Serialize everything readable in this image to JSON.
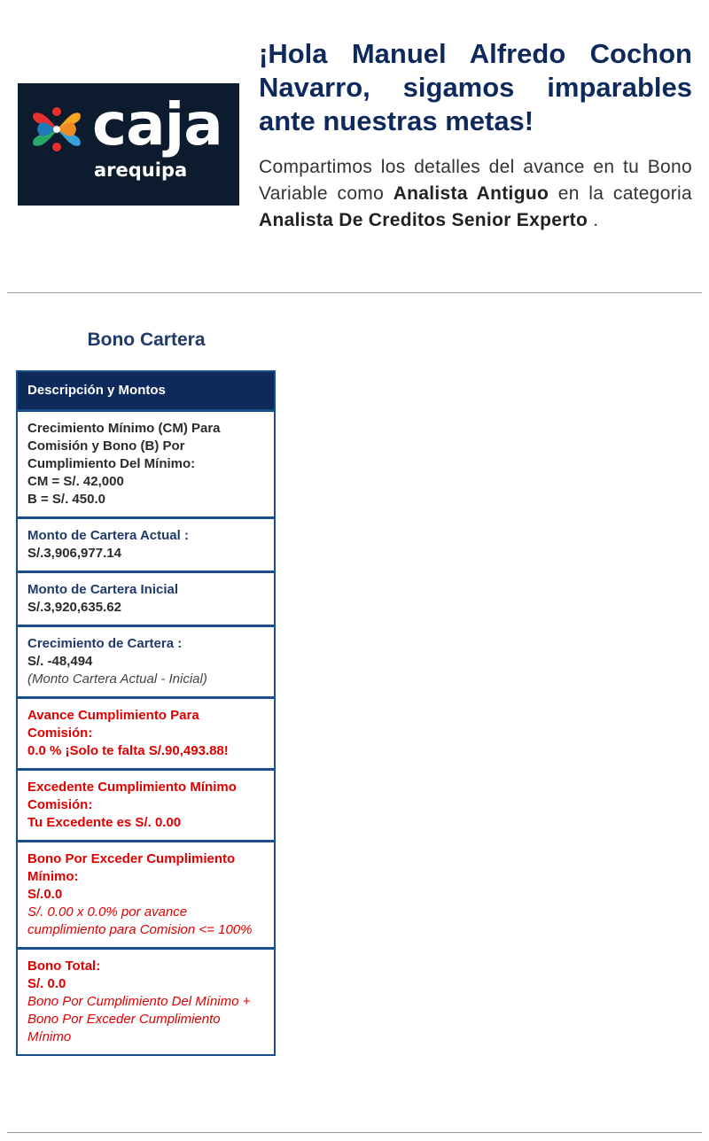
{
  "logo": {
    "word": "caja",
    "sub": "arequipa"
  },
  "header": {
    "greeting": "¡Hola Manuel Alfredo Cochon Navarro, sigamos imparables ante nuestras metas!",
    "intro": {
      "text_1": "Compartimos los detalles del avance en tu Bono Variable como ",
      "role": "Analista Antiguo",
      "text_2": " en la categoria ",
      "category": "Analista De Creditos Senior Experto",
      "text_3": " ."
    }
  },
  "section": {
    "title": "Bono Cartera"
  },
  "table": {
    "header": "Descripción y Montos",
    "rows": [
      {
        "label": "Crecimiento Mínimo (CM) Para Comisión y Bono (B) Por Cumplimiento Del Mínimo:",
        "value": "CM = S/. 42,000",
        "value2": "B = S/. 450.0"
      },
      {
        "label": "Monto de Cartera Actual :",
        "value": "S/.3,906,977.14"
      },
      {
        "label": "Monto de Cartera Inicial",
        "value": "S/.3,920,635.62"
      },
      {
        "label": "Crecimiento de Cartera :",
        "value": "S/. -48,494",
        "note": "(Monto Cartera Actual - Inicial)"
      },
      {
        "label": "Avance Cumplimiento Para Comisión:",
        "value": "0.0 % ¡Solo te falta S/.90,493.88!"
      },
      {
        "label": "Excedente Cumplimiento Mínimo Comisión:",
        "value": "Tu Excedente es S/. 0.00"
      },
      {
        "label": "Bono Por Exceder Cumplimiento Mínimo:",
        "value": "S/.0.0",
        "note": "S/. 0.00 x 0.0% por avance cumplimiento para Comision <= 100%"
      },
      {
        "label": "Bono Total:",
        "value": "S/. 0.0",
        "note": "Bono Por Cumplimiento Del Mínimo + Bono Por Exceder Cumplimiento Mínimo"
      }
    ]
  },
  "colors": {
    "navy": "#0e2a5c",
    "border": "#1a4f8b",
    "alert_red": "#e00000",
    "logo_bg": "#0d1b2e"
  }
}
